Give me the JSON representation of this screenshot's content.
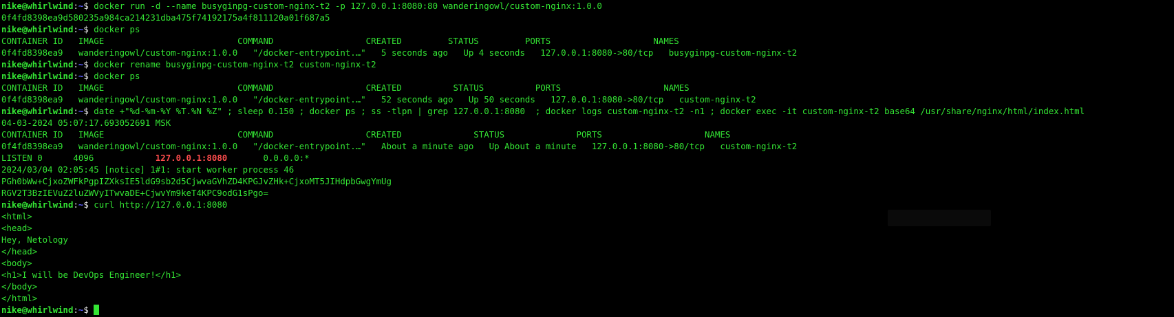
{
  "prompt": {
    "user_host": "nike@whirlwind",
    "sep": ":",
    "path": "~",
    "symbol": "$ "
  },
  "lines": [
    {
      "type": "prompt",
      "cmd": "docker run -d --name busyginpg-custom-nginx-t2 -p 127.0.0.1:8080:80 wanderingowl/custom-nginx:1.0.0"
    },
    {
      "type": "out",
      "text": "0f4fd8398ea9d580235a984ca214231dba475f74192175a4f811120a01f687a5"
    },
    {
      "type": "prompt",
      "cmd": "docker ps"
    },
    {
      "type": "out",
      "text": "CONTAINER ID   IMAGE                          COMMAND                  CREATED         STATUS         PORTS                    NAMES"
    },
    {
      "type": "out",
      "text": "0f4fd8398ea9   wanderingowl/custom-nginx:1.0.0   \"/docker-entrypoint.…\"   5 seconds ago   Up 4 seconds   127.0.0.1:8080->80/tcp   busyginpg-custom-nginx-t2"
    },
    {
      "type": "prompt",
      "cmd": "docker rename busyginpg-custom-nginx-t2 custom-nginx-t2"
    },
    {
      "type": "prompt",
      "cmd": "docker ps"
    },
    {
      "type": "out",
      "text": "CONTAINER ID   IMAGE                          COMMAND                  CREATED          STATUS          PORTS                    NAMES"
    },
    {
      "type": "out",
      "text": "0f4fd8398ea9   wanderingowl/custom-nginx:1.0.0   \"/docker-entrypoint.…\"   52 seconds ago   Up 50 seconds   127.0.0.1:8080->80/tcp   custom-nginx-t2"
    },
    {
      "type": "prompt",
      "cmd": "date +\"%d-%m-%Y %T.%N %Z\" ; sleep 0.150 ; docker ps ; ss -tlpn | grep 127.0.0.1:8080  ; docker logs custom-nginx-t2 -n1 ; docker exec -it custom-nginx-t2 base64 /usr/share/nginx/html/index.html"
    },
    {
      "type": "out",
      "text": "04-03-2024 05:07:17.693052691 MSK"
    },
    {
      "type": "out",
      "text": "CONTAINER ID   IMAGE                          COMMAND                  CREATED              STATUS              PORTS                    NAMES"
    },
    {
      "type": "out",
      "text": "0f4fd8398ea9   wanderingowl/custom-nginx:1.0.0   \"/docker-entrypoint.…\"   About a minute ago   Up About a minute   127.0.0.1:8080->80/tcp   custom-nginx-t2"
    },
    {
      "type": "listen",
      "before": "LISTEN 0      4096            ",
      "match": "127.0.0.1:8080",
      "after": "       0.0.0.0:*"
    },
    {
      "type": "out",
      "text": "2024/03/04 02:05:45 [notice] 1#1: start worker process 46"
    },
    {
      "type": "out",
      "text": "PGh0bWw+CjxoZWFkPgpIZXksIE5ldG9sb2d5CjwvaGVhZD4KPGJvZHk+CjxoMT5JIHdpbGwgYmUg"
    },
    {
      "type": "out",
      "text": "RGV2T3BzIEVuZ2luZWVyITwvaDE+CjwvYm9keT4KPC9odG1sPgo="
    },
    {
      "type": "prompt",
      "cmd": "curl http://127.0.0.1:8080"
    },
    {
      "type": "out",
      "text": "<html>"
    },
    {
      "type": "out",
      "text": "<head>"
    },
    {
      "type": "out",
      "text": "Hey, Netology"
    },
    {
      "type": "out",
      "text": "</head>"
    },
    {
      "type": "out",
      "text": "<body>"
    },
    {
      "type": "out",
      "text": "<h1>I will be DevOps Engineer!</h1>"
    },
    {
      "type": "out",
      "text": "</body>"
    },
    {
      "type": "out",
      "text": "</html>"
    },
    {
      "type": "prompt-cursor",
      "cmd": ""
    }
  ]
}
